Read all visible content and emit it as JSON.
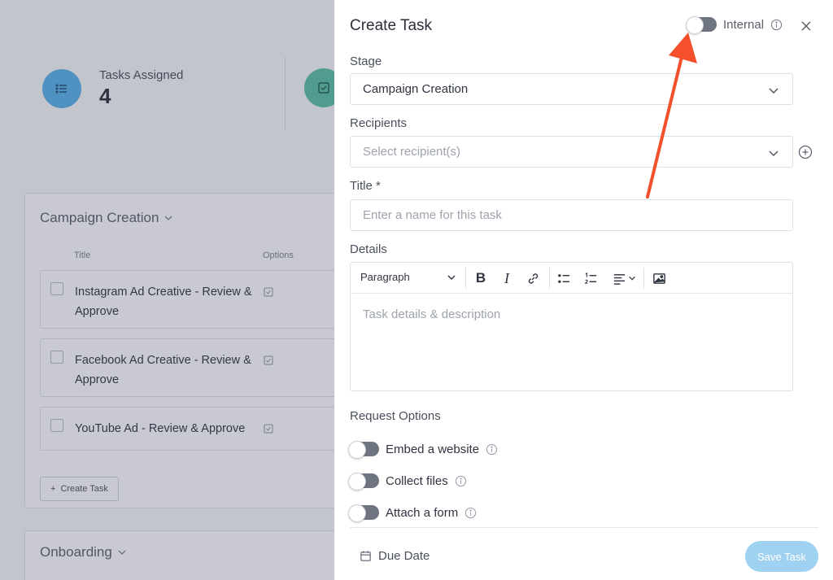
{
  "background": {
    "stats": [
      {
        "label": "Tasks Assigned",
        "value": "4",
        "icon": "list-icon",
        "color": "#56b2ea"
      },
      {
        "label": "",
        "value": "",
        "icon": "checkbox-icon",
        "color": "#5bc0a4"
      }
    ],
    "stages": [
      {
        "name": "Campaign Creation",
        "columns": {
          "title": "Title",
          "options": "Options"
        },
        "tasks": [
          "Instagram Ad Creative - Review & Approve",
          "Facebook Ad Creative - Review & Approve",
          "YouTube Ad - Review & Approve"
        ],
        "create_label": "Create Task"
      },
      {
        "name": "Onboarding"
      }
    ]
  },
  "drawer": {
    "title": "Create Task",
    "internal_label": "Internal",
    "internal_on": false,
    "stage": {
      "label": "Stage",
      "value": "Campaign Creation"
    },
    "recipients": {
      "label": "Recipients",
      "placeholder": "Select recipient(s)"
    },
    "title_field": {
      "label": "Title *",
      "placeholder": "Enter a name for this task"
    },
    "details": {
      "label": "Details",
      "paragraph_style": "Paragraph",
      "placeholder": "Task details & description",
      "toolbar_icons": [
        "bold-icon",
        "italic-icon",
        "link-icon",
        "bullet-list-icon",
        "numbered-list-icon",
        "align-icon",
        "image-icon"
      ]
    },
    "request_options": {
      "label": "Request Options",
      "items": [
        {
          "label": "Embed a website",
          "on": false
        },
        {
          "label": "Collect files",
          "on": false
        },
        {
          "label": "Attach a form",
          "on": false
        }
      ]
    },
    "due_date_label": "Due Date",
    "save_label": "Save Task"
  },
  "colors": {
    "accent": "#9fd1f1",
    "annotation_arrow": "#f4502c",
    "toggle_off": "#6f7482"
  }
}
